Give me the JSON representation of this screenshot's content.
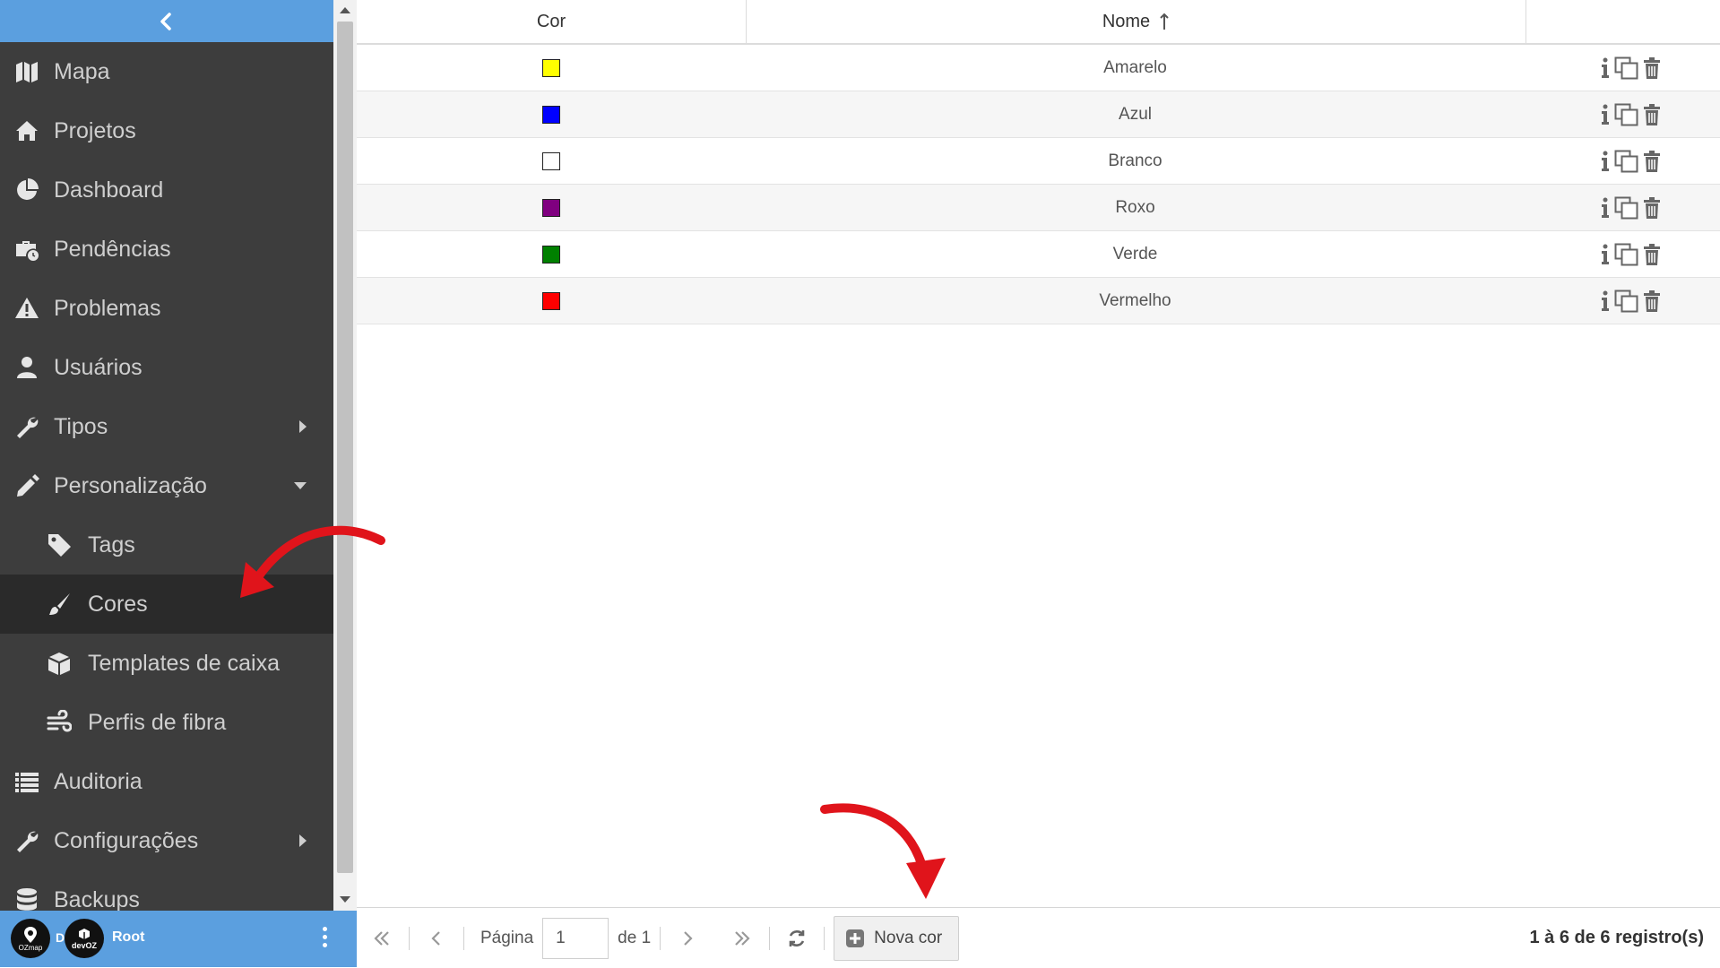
{
  "sidebar": {
    "items": [
      {
        "label": "Mapa",
        "icon": "map-icon"
      },
      {
        "label": "Projetos",
        "icon": "home-icon"
      },
      {
        "label": "Dashboard",
        "icon": "pie-chart-icon"
      },
      {
        "label": "Pendências",
        "icon": "briefcase-clock-icon"
      },
      {
        "label": "Problemas",
        "icon": "warning-icon"
      },
      {
        "label": "Usuários",
        "icon": "user-icon"
      },
      {
        "label": "Tipos",
        "icon": "wrench-icon",
        "caret": "right"
      },
      {
        "label": "Personalização",
        "icon": "pencil-icon",
        "caret": "down"
      },
      {
        "label": "Tags",
        "icon": "tag-icon",
        "sub": true
      },
      {
        "label": "Cores",
        "icon": "brush-icon",
        "sub": true,
        "active": true
      },
      {
        "label": "Templates de caixa",
        "icon": "box-icon",
        "sub": true
      },
      {
        "label": "Perfis de fibra",
        "icon": "wind-icon",
        "sub": true
      },
      {
        "label": "Auditoria",
        "icon": "list-icon"
      },
      {
        "label": "Configurações",
        "icon": "wrench-icon",
        "caret": "right"
      },
      {
        "label": "Backups",
        "icon": "database-icon"
      }
    ]
  },
  "user": {
    "logo_oz": "OZmap",
    "logo_dev": "devOZ",
    "initial": "D",
    "name": "Root"
  },
  "table": {
    "headers": {
      "cor": "Cor",
      "nome": "Nome"
    },
    "rows": [
      {
        "color": "#ffff00",
        "name": "Amarelo"
      },
      {
        "color": "#0000ff",
        "name": "Azul"
      },
      {
        "color": "#ffffff",
        "name": "Branco"
      },
      {
        "color": "#800080",
        "name": "Roxo"
      },
      {
        "color": "#008000",
        "name": "Verde"
      },
      {
        "color": "#ff0000",
        "name": "Vermelho"
      }
    ]
  },
  "pager": {
    "page_label": "Página",
    "page_value": "1",
    "of_label": "de 1",
    "new_button": "Nova cor",
    "records": "1 à 6 de 6 registro(s)"
  },
  "colors": {
    "sidebar_bg": "#3d3d3d",
    "accent": "#5b9fdf",
    "annotation_arrow": "#e0141b"
  }
}
